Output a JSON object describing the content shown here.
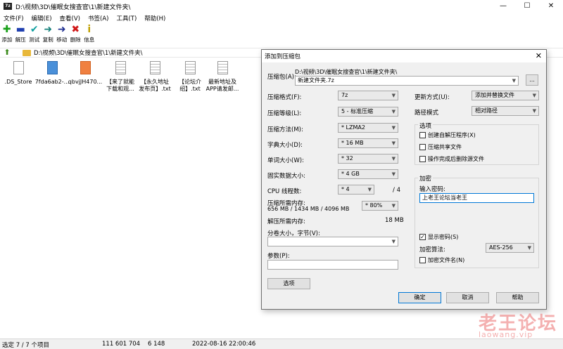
{
  "window": {
    "title": "D:\\视频\\3D\\催眠女搜查官\\1\\新建文件夹\\",
    "app_icon": "7z",
    "minimize": "—",
    "maximize": "☐",
    "close": "✕"
  },
  "menu": [
    "文件(F)",
    "编辑(E)",
    "查看(V)",
    "书签(A)",
    "工具(T)",
    "帮助(H)"
  ],
  "toolbar": [
    {
      "label": "添加",
      "icon": "add-icon",
      "glyph": "✚",
      "color": "#19a019"
    },
    {
      "label": "解压",
      "icon": "extract-icon",
      "glyph": "▬",
      "color": "#1f3fb0"
    },
    {
      "label": "测试",
      "icon": "test-icon",
      "glyph": "✔",
      "color": "#10a0a0"
    },
    {
      "label": "复制",
      "icon": "copy-icon",
      "glyph": "➜",
      "color": "#15807a"
    },
    {
      "label": "移动",
      "icon": "move-icon",
      "glyph": "➜",
      "color": "#1f2f90"
    },
    {
      "label": "删除",
      "icon": "delete-icon",
      "glyph": "✖",
      "color": "#d01818"
    },
    {
      "label": "信息",
      "icon": "info-icon",
      "glyph": "i",
      "color": "#c0a000"
    }
  ],
  "address": "D:\\视频\\3D\\催眠女搜查官\\1\\新建文件夹\\",
  "files": [
    {
      "name": ".DS_Store",
      "icon": "file-icon",
      "lines": [
        ".DS_Store"
      ]
    },
    {
      "name": "7fda6ab2-...",
      "icon": "image-file-icon",
      "lines": [
        "7fda6ab2-..."
      ]
    },
    {
      "name": "qbvjJH470...",
      "icon": "mp4-file-icon",
      "lines": [
        "qbvjJH470..."
      ]
    },
    {
      "name": "【来了就能下载和观...",
      "icon": "text-file-icon",
      "lines": [
        "【来了就能",
        "下载和观..."
      ]
    },
    {
      "name": "【永久地址发布页】.txt",
      "icon": "text-file-icon",
      "lines": [
        "【永久地址",
        "发布页】.txt"
      ]
    },
    {
      "name": "【论坛介绍】.txt",
      "icon": "text-file-icon",
      "lines": [
        "【论坛介",
        "绍】.txt"
      ]
    },
    {
      "name": "最新地址及APP请发邮...",
      "icon": "text-file-icon",
      "lines": [
        "最新地址及",
        "APP请发邮..."
      ]
    }
  ],
  "status": {
    "selected": "选定 7 / 7 个项目",
    "size": "111 601 704",
    "packed": "6 148",
    "modified": "2022-08-16 22:00:46"
  },
  "dialog": {
    "title": "添加到压缩包",
    "archive_label": "压缩包(A):",
    "archive_path": "D:\\视频\\3D\\催眠女搜查官\\1\\新建文件夹\\",
    "archive_name": "新建文件夹.7z",
    "browse_label": "...",
    "format_label": "压缩格式(F):",
    "format_value": "7z",
    "level_label": "压缩等级(L):",
    "level_value": "5 - 标准压缩",
    "method_label": "压缩方法(M):",
    "method_value": "* LZMA2",
    "dict_label": "字典大小(D):",
    "dict_value": "* 16 MB",
    "word_label": "单词大小(W):",
    "word_value": "* 32",
    "solid_label": "固实数据大小:",
    "solid_value": "* 4 GB",
    "cpu_label": "CPU 线程数:",
    "cpu_value": "* 4",
    "cpu_total": "/ 4",
    "mem_comp_label": "压缩所需内存:",
    "mem_comp_detail": "656 MB / 1434 MB / 4096 MB",
    "mem_comp_value": "* 80%",
    "mem_decomp_label": "解压所需内存:",
    "mem_decomp_value": "18 MB",
    "split_label": "分卷大小，字节(V):",
    "params_label": "参数(P):",
    "options_button": "选项",
    "update_label": "更新方式(U):",
    "update_value": "添加并替换文件",
    "path_label": "路径模式",
    "path_value": "相对路径",
    "options_group": "选项",
    "opt_sfx": "创建自解压程序(X)",
    "opt_shared": "压缩共享文件",
    "opt_delete": "操作完成后删除源文件",
    "encrypt_group": "加密",
    "password_label": "输入密码:",
    "password_value": "上老王论坛当老王",
    "show_password": "显示密码(S)",
    "enc_method_label": "加密算法:",
    "enc_method_value": "AES-256",
    "encrypt_names": "加密文件名(N)",
    "ok": "确定",
    "cancel": "取消",
    "help": "帮助"
  },
  "watermark": {
    "line1": "老王论坛",
    "line2": "laowang.vip"
  }
}
